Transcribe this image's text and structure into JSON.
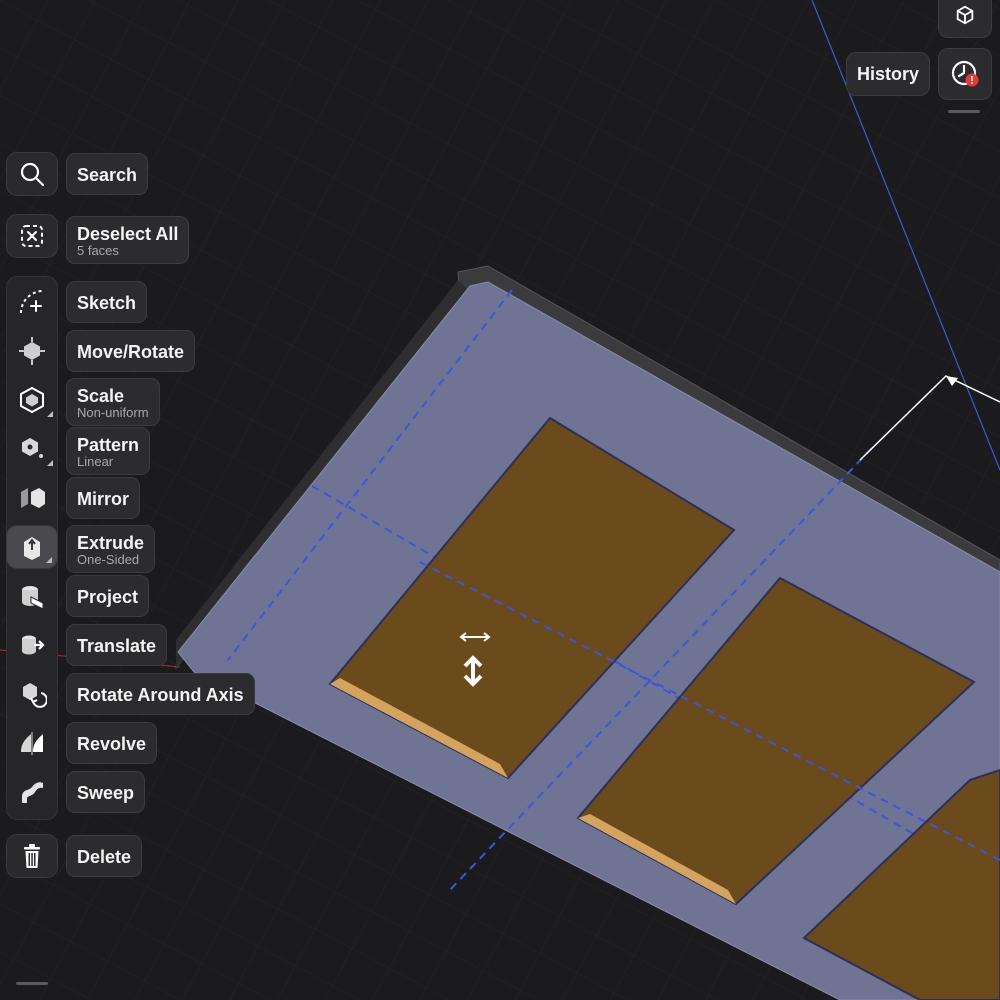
{
  "header": {
    "history_label": "History"
  },
  "toolbar": {
    "search": {
      "label": "Search",
      "icon": "search-icon"
    },
    "deselect": {
      "label": "Deselect All",
      "sub": "5 faces",
      "icon": "deselect-icon"
    },
    "items": [
      {
        "label": "Sketch",
        "sub": "",
        "icon": "sketch-icon"
      },
      {
        "label": "Move/Rotate",
        "sub": "",
        "icon": "move-rotate-icon"
      },
      {
        "label": "Scale",
        "sub": "Non-uniform",
        "icon": "scale-icon"
      },
      {
        "label": "Pattern",
        "sub": "Linear",
        "icon": "pattern-icon"
      },
      {
        "label": "Mirror",
        "sub": "",
        "icon": "mirror-icon"
      },
      {
        "label": "Extrude",
        "sub": "One-Sided",
        "icon": "extrude-icon"
      },
      {
        "label": "Project",
        "sub": "",
        "icon": "project-icon"
      },
      {
        "label": "Translate",
        "sub": "",
        "icon": "translate-icon"
      },
      {
        "label": "Rotate Around Axis",
        "sub": "",
        "icon": "rotate-axis-icon"
      },
      {
        "label": "Revolve",
        "sub": "",
        "icon": "revolve-icon"
      },
      {
        "label": "Sweep",
        "sub": "",
        "icon": "sweep-icon"
      }
    ],
    "delete": {
      "label": "Delete",
      "icon": "trash-icon"
    }
  },
  "colors": {
    "background": "#1b1b1d",
    "plate_face": "#6f7394",
    "plate_edge": "#3b3b3e",
    "selected_face": "#6b4a1c",
    "construction_line": "#3a56e0",
    "badge": "#e53935"
  }
}
